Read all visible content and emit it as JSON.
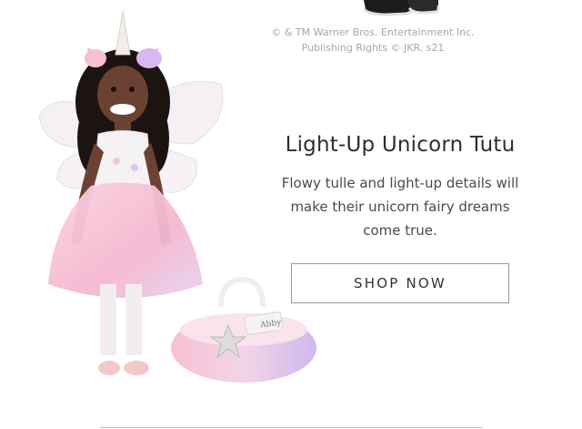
{
  "copyright": {
    "line1": "© & TM Warner Bros.  Entertainment Inc.",
    "line2": "Publishing Rights © JKR. s21"
  },
  "promo": {
    "title": "Light-Up Unicorn Tutu",
    "description": "Flowy tulle and light-up details will make their unicorn fairy dreams come true.",
    "cta_label": "SHOP NOW",
    "basket_tag_text": "Abby"
  },
  "colors": {
    "tulle_pink": "#f7c6d6",
    "tulle_lavender": "#d9c6ef",
    "text_dark": "#2e2e2e",
    "button_border": "#9a9a9a"
  },
  "icons": {
    "shoe": "sneaker-icon"
  }
}
